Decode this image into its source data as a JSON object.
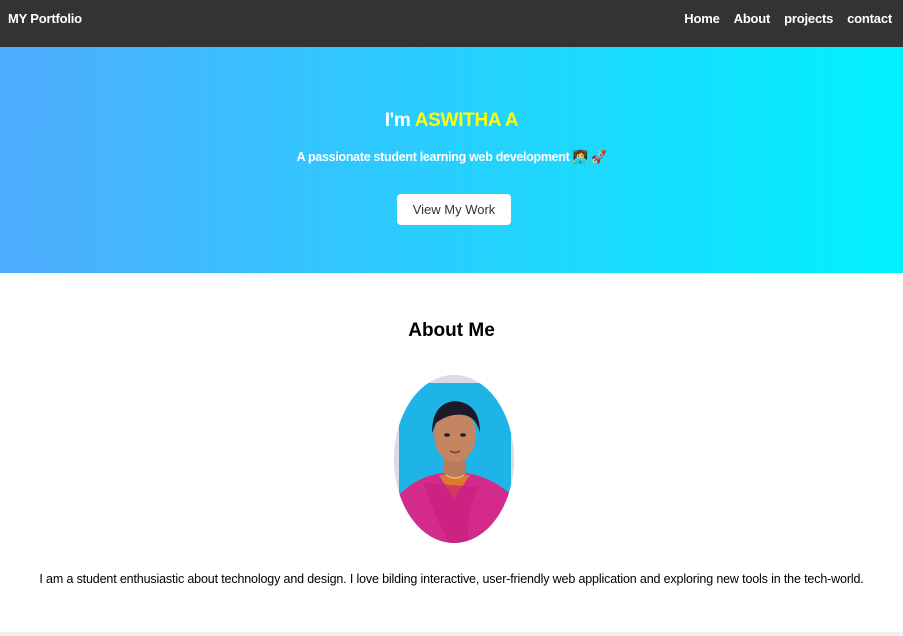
{
  "navbar": {
    "brand": "MY Portfolio",
    "links": [
      "Home",
      "About",
      "projects",
      "contact"
    ]
  },
  "hero": {
    "greeting": "I'm",
    "name": "ASWITHA A",
    "subtitle": "A passionate student learning web development 👩‍💻 🚀",
    "button_label": "View My Work"
  },
  "about": {
    "title": "About Me",
    "photo_icon": "profile-photo",
    "text": "I am a student enthusiastic about technology and design. I love bilding interactive, user-friendly web application and exploring new tools in the tech-world."
  },
  "colors": {
    "navbar_bg": "#333333",
    "hero_gradient_start": "#4facfe",
    "hero_gradient_end": "#00f2fe",
    "name_accent": "#ffff00",
    "button_bg": "#ffffff"
  }
}
